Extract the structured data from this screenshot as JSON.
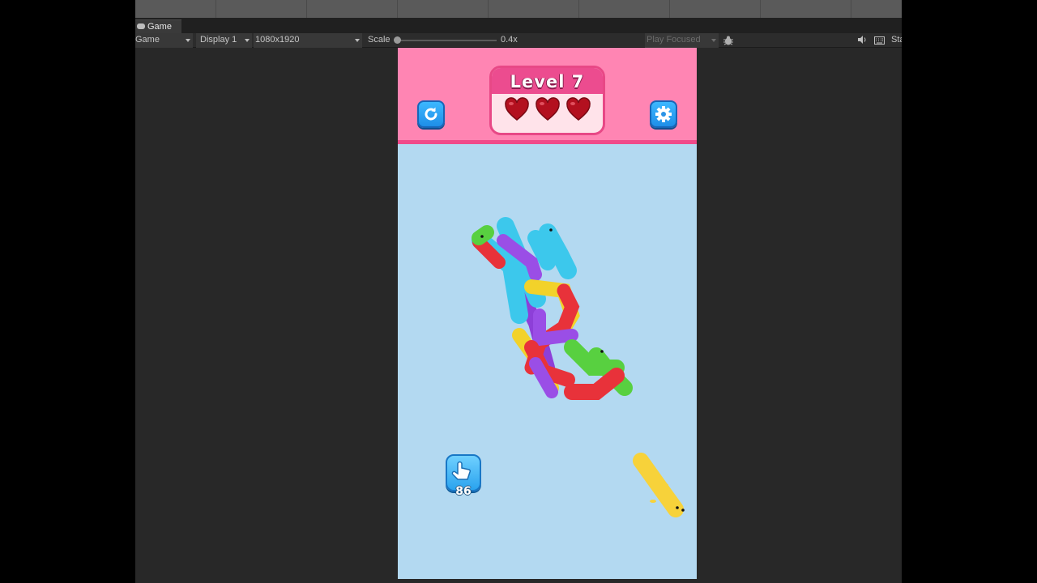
{
  "editor": {
    "tab_label": "Game",
    "toolbar": {
      "view_mode": "Game",
      "display": "Display 1",
      "resolution": "1080x1920",
      "scale_label": "Scale",
      "scale_value": "0.4x",
      "scale_fraction": 0.0,
      "play_mode": "Play Focused",
      "stats_label": "Sta"
    }
  },
  "game": {
    "level_label": "Level 7",
    "lives": 3,
    "taps_remaining": "86",
    "colors": {
      "header": "#ff85b3",
      "background": "#b3d9f1",
      "heart": "#b3101f",
      "button": "#2aa3ee"
    },
    "icons": {
      "restart": "restart-icon",
      "settings": "gear-icon",
      "tap": "hand-tap-icon"
    }
  }
}
